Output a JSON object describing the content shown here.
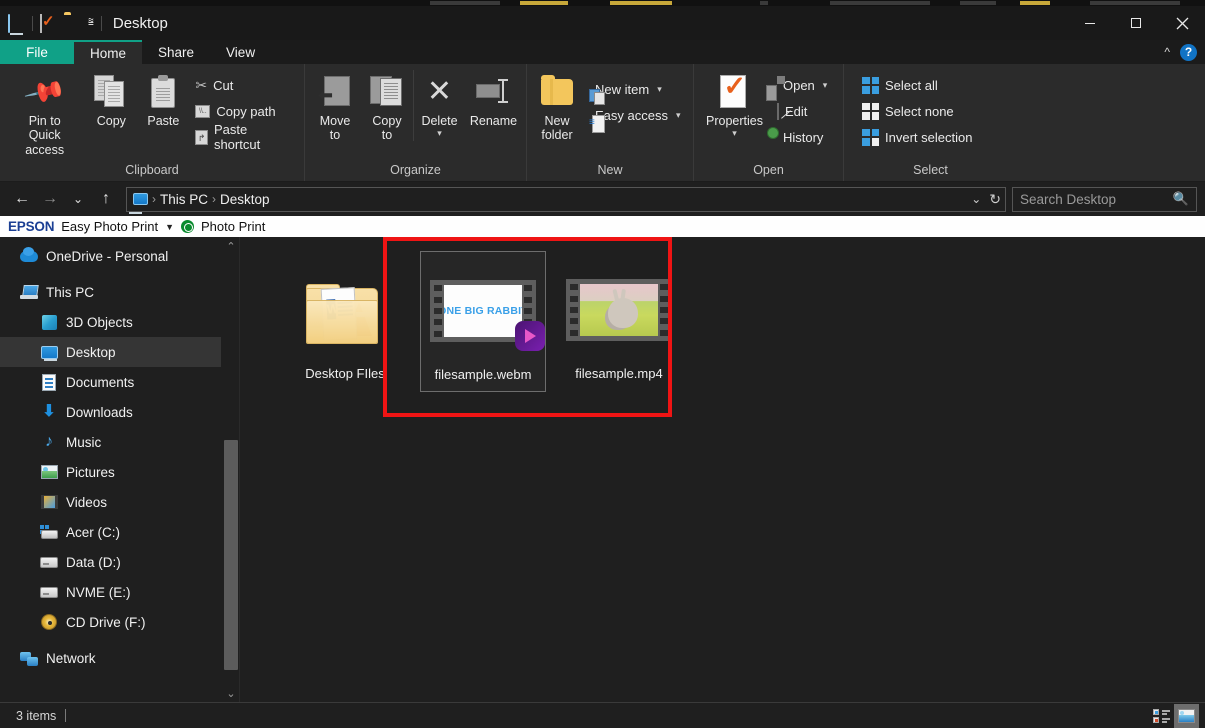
{
  "titlebar": {
    "title": "Desktop",
    "quick_access": [
      {
        "name": "desktop-icon",
        "label": "Desktop"
      },
      {
        "name": "properties-icon",
        "label": "Properties"
      },
      {
        "name": "new-folder-icon",
        "label": "New folder"
      },
      {
        "name": "customize-caret-icon",
        "label": "Customize Quick Access Toolbar"
      }
    ],
    "window_buttons": {
      "minimize": "Minimize",
      "maximize": "Maximize",
      "close": "Close"
    }
  },
  "tabs": [
    {
      "label": "File",
      "kind": "file"
    },
    {
      "label": "Home",
      "kind": "active"
    },
    {
      "label": "Share",
      "kind": "normal"
    },
    {
      "label": "View",
      "kind": "normal"
    }
  ],
  "tabbar_right": {
    "collapse": "^",
    "help": "?"
  },
  "ribbon": {
    "groups": [
      {
        "label": "Clipboard",
        "big": [
          {
            "label": "Pin to Quick\naccess",
            "icon": "pin-icon"
          },
          {
            "label": "Copy",
            "icon": "copy-icon"
          },
          {
            "label": "Paste",
            "icon": "paste-icon"
          }
        ],
        "small": [
          {
            "label": "Cut",
            "icon": "scissors-icon"
          },
          {
            "label": "Copy path",
            "icon": "copy-path-icon"
          },
          {
            "label": "Paste shortcut",
            "icon": "paste-shortcut-icon"
          }
        ]
      },
      {
        "label": "Organize",
        "big": [
          {
            "label": "Move\nto",
            "icon": "move-to-icon",
            "caret": true
          },
          {
            "label": "Copy\nto",
            "icon": "copy-to-icon",
            "caret": true
          },
          {
            "label": "Delete",
            "icon": "delete-icon",
            "caret": true
          },
          {
            "label": "Rename",
            "icon": "rename-icon"
          }
        ],
        "small": []
      },
      {
        "label": "New",
        "big": [
          {
            "label": "New\nfolder",
            "icon": "new-folder-icon"
          }
        ],
        "small": [
          {
            "label": "New item",
            "icon": "new-item-icon",
            "caret": true
          },
          {
            "label": "Easy access",
            "icon": "easy-access-icon",
            "caret": true
          }
        ]
      },
      {
        "label": "Open",
        "big": [
          {
            "label": "Properties",
            "icon": "properties-icon",
            "caret": true
          }
        ],
        "small": [
          {
            "label": "Open",
            "icon": "open-icon",
            "caret": true
          },
          {
            "label": "Edit",
            "icon": "edit-icon"
          },
          {
            "label": "History",
            "icon": "history-icon"
          }
        ]
      },
      {
        "label": "Select",
        "big": [],
        "small": [
          {
            "label": "Select all",
            "icon": "select-all-icon"
          },
          {
            "label": "Select none",
            "icon": "select-none-icon"
          },
          {
            "label": "Invert selection",
            "icon": "invert-selection-icon"
          }
        ]
      }
    ]
  },
  "addressbar": {
    "back": "←",
    "forward": "→",
    "recent": "⌄",
    "up": "↑",
    "breadcrumbs": [
      "This PC",
      "Desktop"
    ],
    "breadcrumb_sep": "›",
    "dropdown": "⌄",
    "refresh": "↻",
    "search_placeholder": "Search Desktop",
    "search_value": ""
  },
  "epson_bar": {
    "logo": "EPSON",
    "menu": "Easy Photo Print",
    "caret": "▼",
    "photo_print": "Photo Print"
  },
  "sidebar": {
    "items": [
      {
        "label": "OneDrive - Personal",
        "icon": "onedrive-icon",
        "indent": false,
        "selected": false
      },
      {
        "label": "This PC",
        "icon": "this-pc-icon",
        "indent": false,
        "selected": false
      },
      {
        "label": "3D Objects",
        "icon": "3d-objects-icon",
        "indent": true,
        "selected": false
      },
      {
        "label": "Desktop",
        "icon": "desktop-icon",
        "indent": true,
        "selected": true
      },
      {
        "label": "Documents",
        "icon": "documents-icon",
        "indent": true,
        "selected": false
      },
      {
        "label": "Downloads",
        "icon": "downloads-icon",
        "indent": true,
        "selected": false
      },
      {
        "label": "Music",
        "icon": "music-icon",
        "indent": true,
        "selected": false
      },
      {
        "label": "Pictures",
        "icon": "pictures-icon",
        "indent": true,
        "selected": false
      },
      {
        "label": "Videos",
        "icon": "videos-icon",
        "indent": true,
        "selected": false
      },
      {
        "label": "Acer (C:)",
        "icon": "drive-c-icon",
        "indent": true,
        "selected": false
      },
      {
        "label": "Data (D:)",
        "icon": "drive-d-icon",
        "indent": true,
        "selected": false
      },
      {
        "label": "NVME (E:)",
        "icon": "drive-e-icon",
        "indent": true,
        "selected": false
      },
      {
        "label": "CD Drive (F:)",
        "icon": "cd-drive-icon",
        "indent": true,
        "selected": false
      },
      {
        "label": "Network",
        "icon": "network-icon",
        "indent": false,
        "selected": false
      }
    ],
    "scroll_up": "⌃",
    "scroll_down": "⌄"
  },
  "files": [
    {
      "name": "Desktop FIles",
      "type": "folder",
      "selected": false
    },
    {
      "name": "filesample.webm",
      "type": "video-white",
      "selected": true,
      "thumb_text": "ONE BIG RABBIT"
    },
    {
      "name": "filesample.mp4",
      "type": "video-rabbit",
      "selected": false
    }
  ],
  "annotation": {
    "color": "#ef1414",
    "shape": "rectangle"
  },
  "statusbar": {
    "item_count": "3 items",
    "view_details": "Details view",
    "view_large_icons": "Large icons view"
  },
  "colors": {
    "accent_teal": "#10a187",
    "window_bg": "#1f1f1f",
    "ribbon_bg": "#2b2b2b",
    "annotation_red": "#ef1414",
    "selection_gray": "#353535"
  }
}
